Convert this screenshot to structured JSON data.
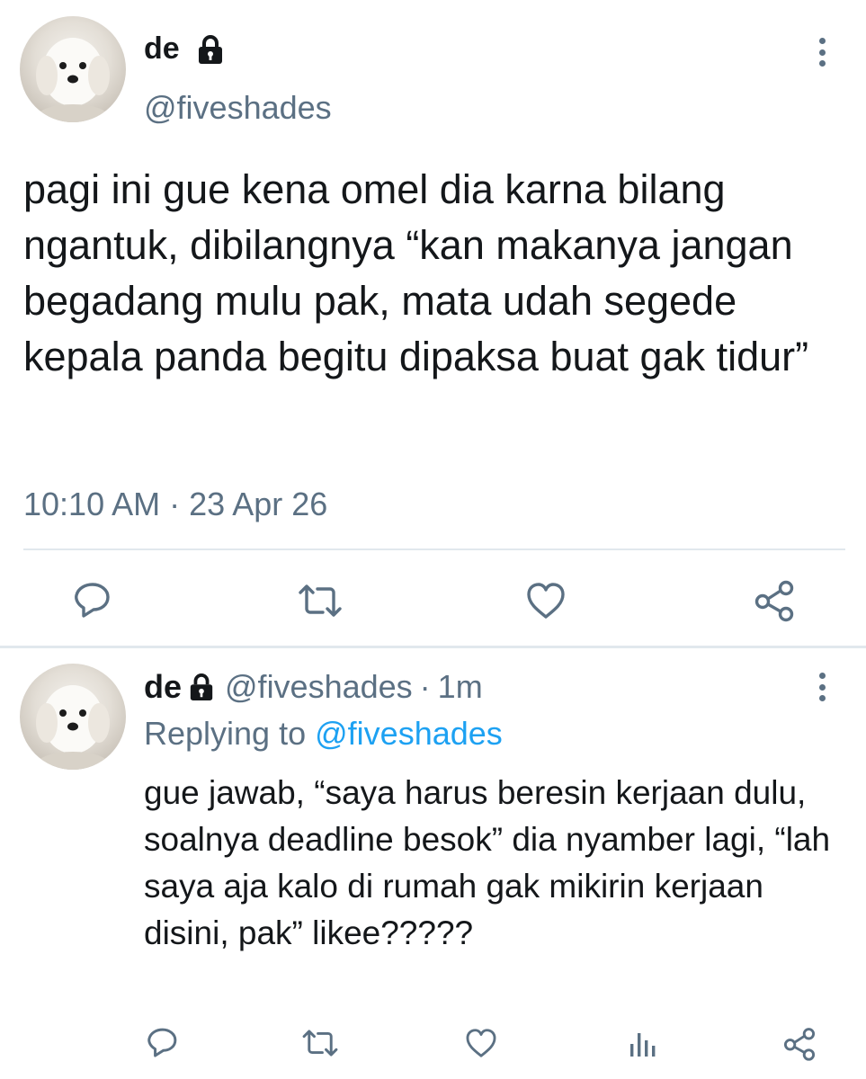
{
  "tweet": {
    "display_name": "de",
    "handle": "@fiveshades",
    "lock_icon": "lock-icon",
    "more_icon": "more-vertical-icon",
    "text": "pagi ini gue kena omel dia karna bilang ngantuk, dibilangnya “kan makanya jangan begadang mulu pak, mata udah segede kepala panda begitu dipaksa buat gak tidur”",
    "time": "10:10 AM",
    "separator": "·",
    "date": "23 Apr 26",
    "actions": [
      "reply-icon",
      "retweet-icon",
      "like-icon",
      "share-icon"
    ]
  },
  "reply": {
    "display_name": "de",
    "handle": "@fiveshades",
    "separator": "·",
    "age": "1m",
    "replying_label": "Replying to",
    "replying_to": "@fiveshades",
    "text": "gue jawab, “saya harus beresin kerjaan dulu, soalnya deadline besok” dia nyamber lagi, “lah saya aja kalo di rumah gak mikirin kerjaan disini, pak” likee?????",
    "actions": [
      "reply-icon",
      "retweet-icon",
      "like-icon",
      "analytics-icon",
      "share-icon"
    ]
  },
  "colors": {
    "text": "#14171a",
    "muted": "#5b7083",
    "link": "#1da1f2",
    "divider": "#e1e8ed"
  }
}
